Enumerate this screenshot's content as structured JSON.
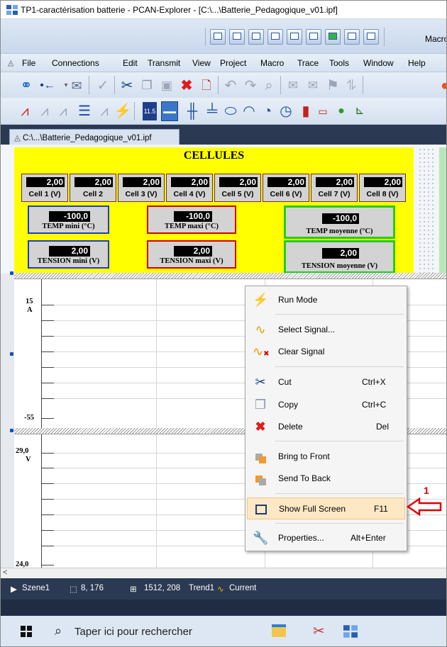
{
  "window": {
    "title": "TP1-caractérisation batterie - PCAN-Explorer - [C:\\...\\Batterie_Pedagogique_v01.ipf]"
  },
  "toolbar_macro_label": "Macro",
  "menu": [
    "File",
    "Connections",
    "Edit",
    "Transmit",
    "View",
    "Project",
    "Macro",
    "Trace",
    "Tools",
    "Window",
    "Help"
  ],
  "toolbar_icons": {
    "row1": [
      "connect-icon",
      "transmit-arrow-icon",
      "message-timer-icon",
      "check-icon",
      "cut-icon",
      "copy-icon",
      "paste-icon",
      "delete-icon",
      "new-doc-icon",
      "undo-icon",
      "redo-icon",
      "find-icon",
      "message-filter-icon",
      "symbol-icon",
      "step-icon",
      "record-icon"
    ],
    "row2": [
      "line-chart-icon",
      "chart-icon",
      "chart-2-icon",
      "list-icon",
      "chart-3-icon",
      "lightning-icon",
      "numeric-display-icon",
      "led-display-icon",
      "slider-icon",
      "slider-2-icon",
      "ellipse-icon",
      "gauge-icon",
      "gauge-2-icon",
      "dial-icon",
      "indicator-icon",
      "bar-icon",
      "green-dot-icon",
      "trend-icon"
    ]
  },
  "doc_tab": "C:\\...\\Batterie_Pedagogique_v01.ipf",
  "panel": {
    "title": "CELLULES",
    "cells": [
      {
        "value": "2,00",
        "label": "Cell 1 (V)"
      },
      {
        "value": "2,00",
        "label": "Cell 2"
      },
      {
        "value": "2,00",
        "label": "Cell 3 (V)"
      },
      {
        "value": "2,00",
        "label": "Cell 4 (V)"
      },
      {
        "value": "2,00",
        "label": "Cell 5 (V)"
      },
      {
        "value": "2,00",
        "label": "Cell 6 (V)"
      },
      {
        "value": "2,00",
        "label": "Cell 7 (V)"
      },
      {
        "value": "2,00",
        "label": "Cell 8 (V)"
      }
    ],
    "temp_min": {
      "value": "-100,0",
      "label": "TEMP mini (°C)"
    },
    "temp_max": {
      "value": "-100,0",
      "label": "TEMP maxi (°C)"
    },
    "temp_avg": {
      "value": "-100,0",
      "label": "TEMP moyenne (°C)"
    },
    "volt_min": {
      "value": "2,00",
      "label": "TENSION mini (V)"
    },
    "volt_max": {
      "value": "2,00",
      "label": "TENSION maxi (V)"
    },
    "volt_avg": {
      "value": "2,00",
      "label": "TENSION moyenne  (V)"
    },
    "colors": {
      "background": "#ffff00",
      "blue_border": "#1f3fbf",
      "red_border": "#d40000",
      "green_border": "#22cc22"
    }
  },
  "chart1": {
    "ymax_label": "15",
    "unit": "A",
    "ymin_label": "-55"
  },
  "chart2": {
    "ymax_label": "29,0",
    "unit": "V",
    "ymin_label": "24,0"
  },
  "context_menu": {
    "items": [
      {
        "label": "Run Mode",
        "shortcut": "",
        "icon": "lightning-icon"
      },
      {
        "label": "Select Signal...",
        "shortcut": "",
        "icon": "signal-icon"
      },
      {
        "label": "Clear Signal",
        "shortcut": "",
        "icon": "clear-signal-icon"
      },
      {
        "label": "Cut",
        "shortcut": "Ctrl+X",
        "icon": "scissors-icon"
      },
      {
        "label": "Copy",
        "shortcut": "Ctrl+C",
        "icon": "copy-icon"
      },
      {
        "label": "Delete",
        "shortcut": "Del",
        "icon": "delete-x-icon"
      },
      {
        "label": "Bring to Front",
        "shortcut": "",
        "icon": "bring-front-icon"
      },
      {
        "label": "Send To Back",
        "shortcut": "",
        "icon": "send-back-icon"
      },
      {
        "label": "Show Full Screen",
        "shortcut": "F11",
        "icon": "fullscreen-icon",
        "highlighted": true
      },
      {
        "label": "Properties...",
        "shortcut": "Alt+Enter",
        "icon": "wrench-icon"
      }
    ]
  },
  "annotation": {
    "number": "1",
    "color": "#e00000"
  },
  "statusbar": {
    "scene": "Szene1",
    "cursor": "8, 176",
    "size": "1512, 208",
    "trend": "Trend1",
    "signal": "Current"
  },
  "taskbar": {
    "search_placeholder": "Taper ici pour rechercher"
  }
}
